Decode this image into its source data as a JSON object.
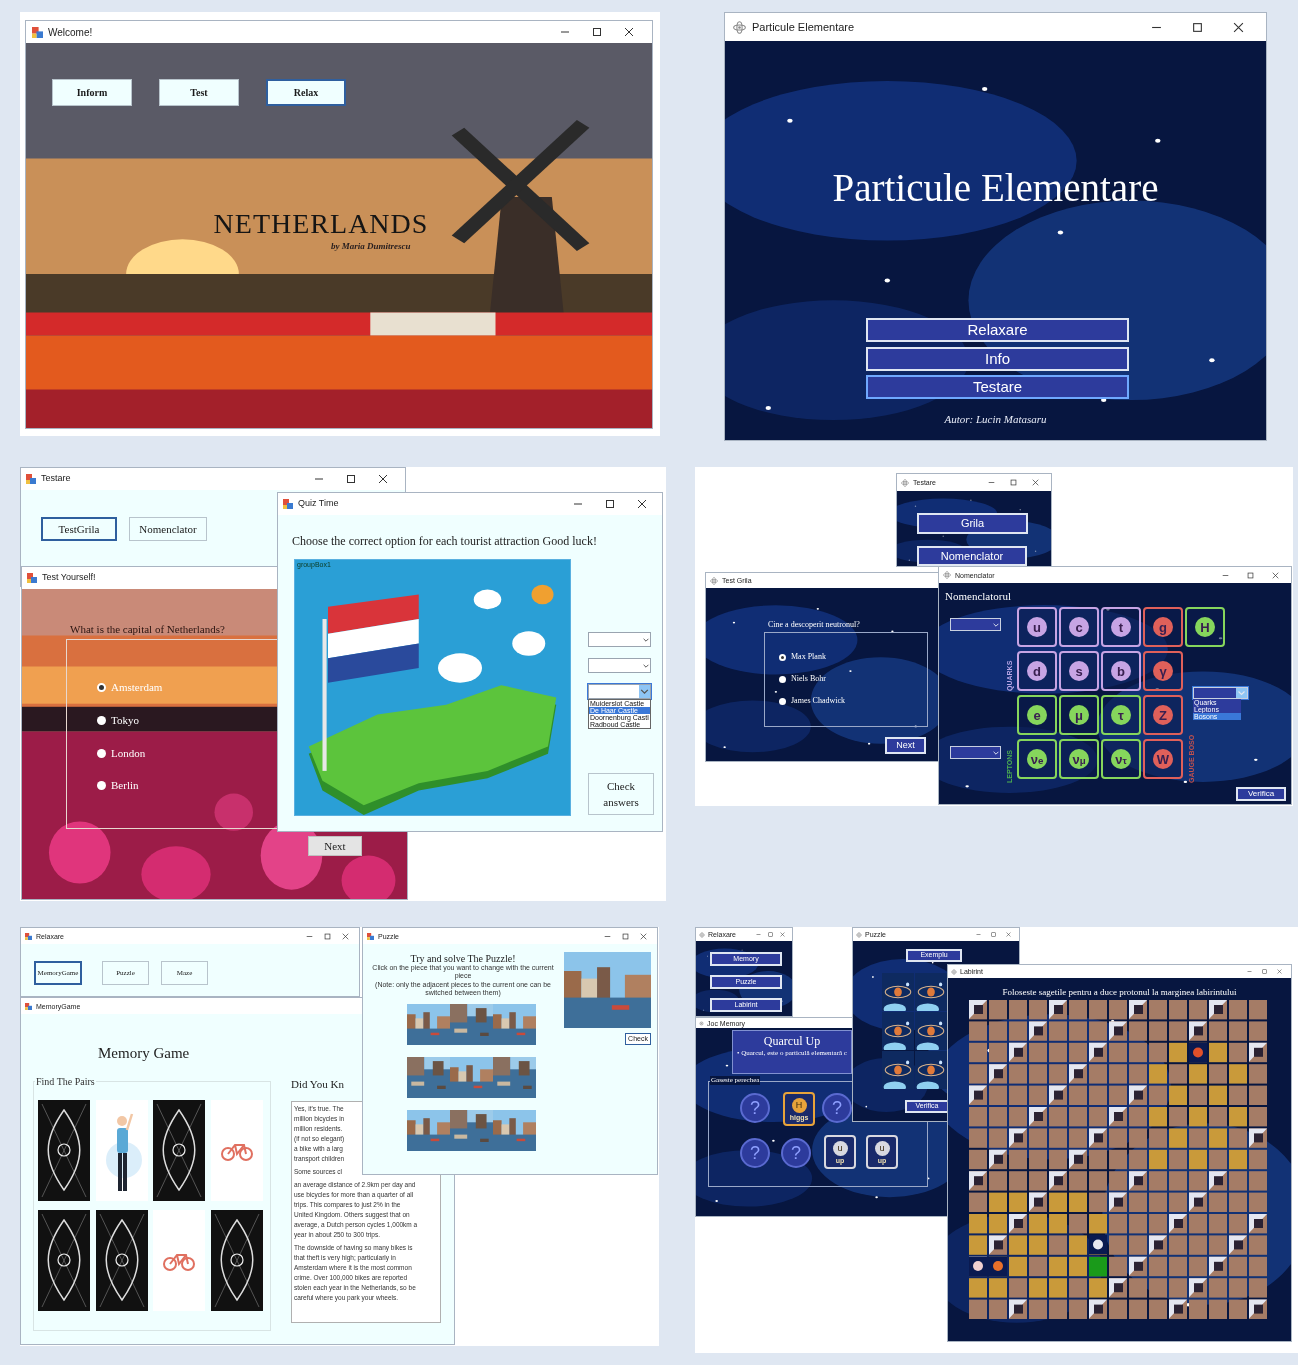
{
  "welcome_window": {
    "title": "Welcome!",
    "buttons": [
      {
        "label": "Inform",
        "focused": false
      },
      {
        "label": "Test",
        "focused": false
      },
      {
        "label": "Relax",
        "focused": true
      }
    ],
    "heading": "NETHERLANDS",
    "byline": "by Maria Dumitrescu"
  },
  "particule_window": {
    "title": "Particule Elementare",
    "heading": "Particule Elementare",
    "buttons": [
      {
        "label": "Relaxare",
        "focused": false
      },
      {
        "label": "Info",
        "focused": false
      },
      {
        "label": "Testare",
        "focused": true
      }
    ],
    "author": "Autor: Lucin Matasaru"
  },
  "testare_window": {
    "title": "Testare",
    "buttons": [
      {
        "label": "TestGrila",
        "focused": true
      },
      {
        "label": "Nomenclator",
        "focused": false
      }
    ]
  },
  "test_yourself_window": {
    "title": "Test Yourself!",
    "question": "What is the capital of Netherlands?",
    "options": [
      {
        "label": "Amsterdam",
        "selected": true
      },
      {
        "label": "Tokyo",
        "selected": false
      },
      {
        "label": "London",
        "selected": false
      },
      {
        "label": "Berlin",
        "selected": false
      }
    ],
    "next_button": "Next"
  },
  "quiz_window": {
    "title": "Quiz Time",
    "instruction": "Choose the correct option for each tourist attraction Good luck!",
    "group_label": "groupBox1",
    "dropdowns": [
      {
        "expanded": false
      },
      {
        "expanded": false
      },
      {
        "expanded": true,
        "options": [
          {
            "label": "Muiderslot Castle",
            "selected": false
          },
          {
            "label": "De Haar Castle",
            "selected": true
          },
          {
            "label": "Doornenburg Castl",
            "selected": false
          },
          {
            "label": "Radboud Castle",
            "selected": false
          }
        ]
      }
    ],
    "check_button": "Check answers"
  },
  "testare_space_window": {
    "title": "Testare",
    "buttons": [
      "Grila",
      "Nomenclator"
    ]
  },
  "test_grila_window": {
    "title": "Test Grila",
    "question": "Cine a descoperit neutronul?",
    "options": [
      {
        "label": "Max Plank",
        "selected": true
      },
      {
        "label": "Niels Bohr",
        "selected": false
      },
      {
        "label": "James Chadwick",
        "selected": false
      }
    ],
    "next_button": "Next"
  },
  "nomenclator_window": {
    "title": "Nomenclator",
    "heading": "Nomenclatorul",
    "particles": [
      {
        "symbol": "u",
        "color": "#c7a4e4"
      },
      {
        "symbol": "c",
        "color": "#c7a4e4"
      },
      {
        "symbol": "t",
        "color": "#c7a4e4"
      },
      {
        "symbol": "g",
        "color": "#e0605a"
      },
      {
        "symbol": "H",
        "color": "#86d65c"
      },
      {
        "symbol": "d",
        "color": "#c7a4e4"
      },
      {
        "symbol": "s",
        "color": "#c7a4e4"
      },
      {
        "symbol": "b",
        "color": "#c7a4e4"
      },
      {
        "symbol": "γ",
        "color": "#e0605a"
      },
      {
        "symbol": "e",
        "color": "#86d65c"
      },
      {
        "symbol": "μ",
        "color": "#86d65c"
      },
      {
        "symbol": "τ",
        "color": "#86d65c"
      },
      {
        "symbol": "Z",
        "color": "#e0605a"
      },
      {
        "symbol": "ν$_{e}$",
        "color": "#86d65c"
      },
      {
        "symbol": "ν$_{μ}$",
        "color": "#86d65c"
      },
      {
        "symbol": "ν$_{τ}$",
        "color": "#86d65c"
      },
      {
        "symbol": "W",
        "color": "#e0605a"
      }
    ],
    "axis_labels": [
      {
        "label": "QUARKS",
        "color": "#b9a6e6"
      },
      {
        "label": "LEPTONS",
        "color": "#4caf50"
      },
      {
        "label": "GAUGE BOSO",
        "color": "#c0504d"
      }
    ],
    "dropdowns": [
      {
        "expanded": false
      },
      {
        "expanded": false
      },
      {
        "expanded": true,
        "options": [
          {
            "label": "Quarks",
            "selected": false
          },
          {
            "label": "Leptons",
            "selected": false
          },
          {
            "label": "Bosons",
            "selected": true
          }
        ]
      }
    ],
    "check_button": "Verifica"
  },
  "relaxare_window": {
    "title": "Relaxare",
    "buttons": [
      {
        "label": "MemoryGame",
        "focused": true
      },
      {
        "label": "Puzzle",
        "focused": false
      },
      {
        "label": "Maze",
        "focused": false
      }
    ]
  },
  "memory_window": {
    "title": "MemoryGame",
    "heading": "Memory Game",
    "group_title": "Find The Pairs",
    "cards": [
      {
        "kind": "back"
      },
      {
        "kind": "person"
      },
      {
        "kind": "back"
      },
      {
        "kind": "bike"
      },
      {
        "kind": "back"
      },
      {
        "kind": "back"
      },
      {
        "kind": "bike"
      },
      {
        "kind": "back"
      }
    ],
    "side_heading": "Did You Kn",
    "fact_paragraphs": [
      [
        "Yes, it's true. The",
        "million bicycles in",
        "million residents.",
        "(if not so elegant)",
        "a bike with a larg",
        "transport children"
      ],
      [
        "Some sources cl"
      ],
      [
        "an average distance of 2.9km per day and",
        "use bicycles for more than a quarter of all",
        "trips. This compares to just 2% in the",
        "United Kingdom. Others suggest that on",
        "average, a Dutch person cycles 1,000km a",
        "year in about 250 to 300 trips."
      ],
      [
        "The downside of having so many bikes is",
        "that theft is very high; particularly in",
        "Amsterdam where it is the most common",
        "crime. Over 100,000 bikes are reported",
        "stolen each year in the Netherlands, so be",
        "careful where you park your wheels."
      ]
    ]
  },
  "puzzle_window": {
    "title": "Puzzle",
    "heading": "Try and solve The Puzzle!",
    "instruction": "Click on the piece that you want to change with the current piece",
    "note": "(Note: only the adjacent pieces to the current one can be switched between them)",
    "check_button": "Check"
  },
  "relaxare_space_window": {
    "title": "Relaxare",
    "buttons": [
      "Memory",
      "Puzzle",
      "Labirint"
    ]
  },
  "joc_memory_window": {
    "title": "Joc Memory",
    "card_title": "Quarcul Up",
    "card_bullet": "• Quarcul, este o particulă elementară c",
    "group_title": "Gaseste perechea",
    "cards": [
      {
        "kind": "hidden",
        "symbol": "?"
      },
      {
        "kind": "revealed",
        "symbol": "H",
        "name": "higgs",
        "color": "#e8a33a"
      },
      {
        "kind": "hidden",
        "symbol": "?"
      },
      {
        "kind": "hidden",
        "symbol": "?"
      },
      {
        "kind": "hidden",
        "symbol": "?"
      },
      {
        "kind": "revealed",
        "symbol": "u",
        "name": "up",
        "color": "#d9d9e0"
      },
      {
        "kind": "revealed",
        "symbol": "u",
        "name": "up",
        "color": "#d9d9e0"
      }
    ]
  },
  "puzzle_space_window": {
    "title": "Puzzle",
    "example_button": "Exemplu",
    "check_button": "Verifica"
  },
  "labirint_window": {
    "title": "Labirint",
    "instruction": "Foloseste sagetile pentru a duce protonul la marginea labirintului"
  }
}
